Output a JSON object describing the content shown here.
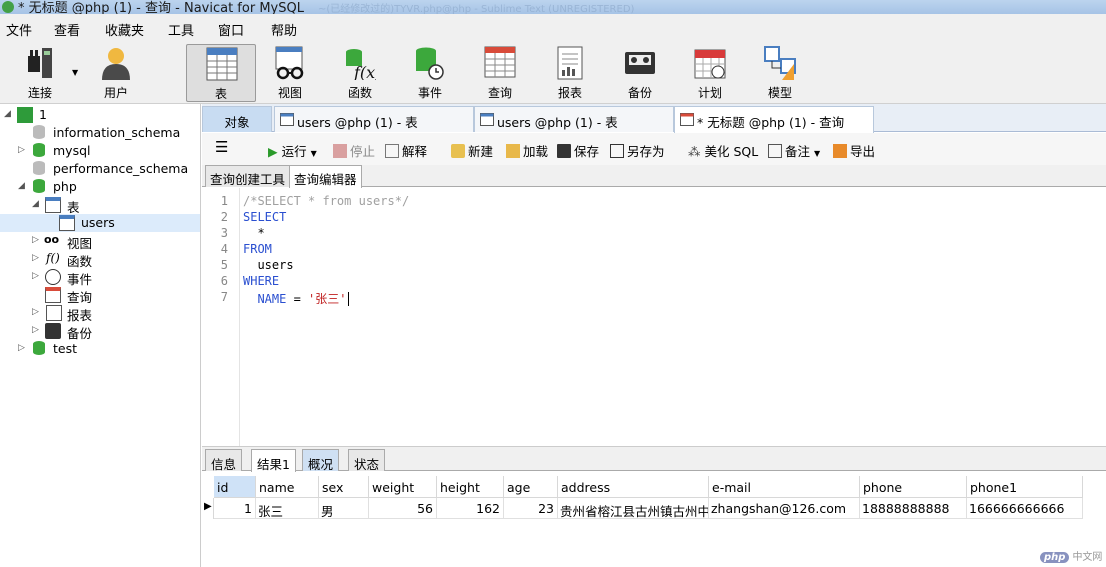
{
  "window": {
    "title": "* 无标题 @php (1) - 查询 - Navicat for MySQL",
    "bg_title": "~(已经修改过的)TYVR.php@php - Sublime Text (UNREGISTERED)"
  },
  "menu": [
    "文件",
    "查看",
    "收藏夹",
    "工具",
    "窗口",
    "帮助"
  ],
  "toolbar": {
    "connect": "连接",
    "user": "用户",
    "table": "表",
    "view": "视图",
    "function": "函数",
    "event": "事件",
    "query": "查询",
    "report": "报表",
    "backup": "备份",
    "schedule": "计划",
    "model": "模型"
  },
  "tree": {
    "root": "1",
    "dbs": [
      "information_schema",
      "mysql",
      "performance_schema",
      "php",
      "test"
    ],
    "php_children": {
      "tables": "表",
      "table_users": "users",
      "views": "视图",
      "functions": "函数",
      "events": "事件",
      "queries": "查询",
      "reports": "报表",
      "backups": "备份"
    }
  },
  "tabs": {
    "objects": "对象",
    "tab1": "users @php (1) - 表",
    "tab2": "users @php (1) - 表",
    "tab3": "* 无标题 @php (1) - 查询"
  },
  "query_toolbar": {
    "run": "运行",
    "stop": "停止",
    "explain": "解释",
    "new": "新建",
    "load": "加载",
    "save": "保存",
    "save_as": "另存为",
    "beautify": "美化 SQL",
    "comment": "备注",
    "export": "导出"
  },
  "editor_tabs": {
    "builder": "查询创建工具",
    "editor": "查询编辑器"
  },
  "code": {
    "line1": "/*SELECT * from users*/",
    "line2": "SELECT",
    "line3": "  *",
    "line4": "FROM",
    "line5": "  users",
    "line6": "WHERE",
    "line7_kw": "  NAME",
    "line7_op": " = ",
    "line7_str": "'张三'",
    "line_numbers": [
      "1",
      "2",
      "3",
      "4",
      "5",
      "6",
      "7"
    ]
  },
  "result_tabs": {
    "info": "信息",
    "result1": "结果1",
    "overview": "概况",
    "status": "状态"
  },
  "grid": {
    "columns": [
      "id",
      "name",
      "sex",
      "weight",
      "height",
      "age",
      "address",
      "e-mail",
      "phone",
      "phone1"
    ],
    "row": [
      "1",
      "张三",
      "男",
      "56",
      "162",
      "23",
      "贵州省榕江县古州镇古州中路",
      "zhangshan@126.com",
      "18888888888",
      "166666666666"
    ]
  },
  "watermark": {
    "logo": "php",
    "text": "中文网"
  },
  "colors": {
    "accent": "#3c8dde",
    "db_green": "#3ca83c",
    "keyword": "#2a4fd0",
    "string": "#c02020"
  }
}
